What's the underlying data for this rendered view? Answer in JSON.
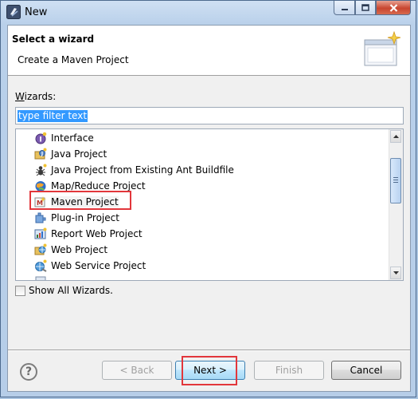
{
  "window": {
    "title": "New"
  },
  "banner": {
    "title": "Select a wizard",
    "subtitle": "Create a Maven Project"
  },
  "filter": {
    "label": "Wizards:",
    "value": "type filter text"
  },
  "wizards": [
    {
      "label": "Interface",
      "icon": "interface-icon"
    },
    {
      "label": "Java Project",
      "icon": "java-project-icon"
    },
    {
      "label": "Java Project from Existing Ant Buildfile",
      "icon": "ant-icon"
    },
    {
      "label": "Map/Reduce Project",
      "icon": "mapreduce-icon"
    },
    {
      "label": "Maven Project",
      "icon": "maven-icon",
      "selected": true
    },
    {
      "label": "Plug-in Project",
      "icon": "plugin-icon"
    },
    {
      "label": "Report Web Project",
      "icon": "report-icon"
    },
    {
      "label": "Web Project",
      "icon": "web-project-icon"
    },
    {
      "label": "Web Service Project",
      "icon": "web-service-icon"
    }
  ],
  "options": {
    "show_all_wizards": "Show All Wizards.",
    "show_all_checked": false
  },
  "buttons": {
    "back": "< Back",
    "next": "Next >",
    "finish": "Finish",
    "cancel": "Cancel",
    "help": "?"
  },
  "colors": {
    "highlight_red": "#e2363b",
    "selection_blue": "#3399ff"
  }
}
